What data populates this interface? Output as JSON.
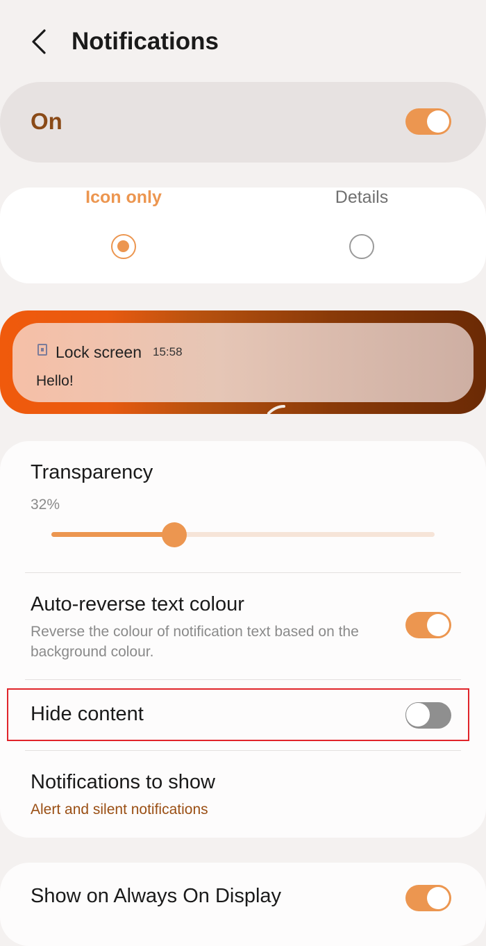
{
  "header": {
    "title": "Notifications",
    "back_icon": "chevron-left-icon"
  },
  "master": {
    "label": "On",
    "enabled": true
  },
  "style_options": [
    {
      "label": "Icon only",
      "selected": true
    },
    {
      "label": "Details",
      "selected": false
    }
  ],
  "preview": {
    "app_name": "Lock screen",
    "time": "15:58",
    "message": "Hello!"
  },
  "settings": {
    "transparency": {
      "title": "Transparency",
      "value_text": "32%",
      "value": 32
    },
    "auto_reverse": {
      "title": "Auto-reverse text colour",
      "subtitle": "Reverse the colour of notification text based on the background colour.",
      "enabled": true
    },
    "hide_content": {
      "title": "Hide content",
      "enabled": false
    },
    "to_show": {
      "title": "Notifications to show",
      "value": "Alert and silent notifications"
    }
  },
  "aod": {
    "title": "Show on Always On Display",
    "enabled": true
  },
  "colors": {
    "accent": "#ec9650",
    "master_label": "#8a4a17",
    "link_value": "#9a4f14",
    "highlight": "#e0242a"
  }
}
